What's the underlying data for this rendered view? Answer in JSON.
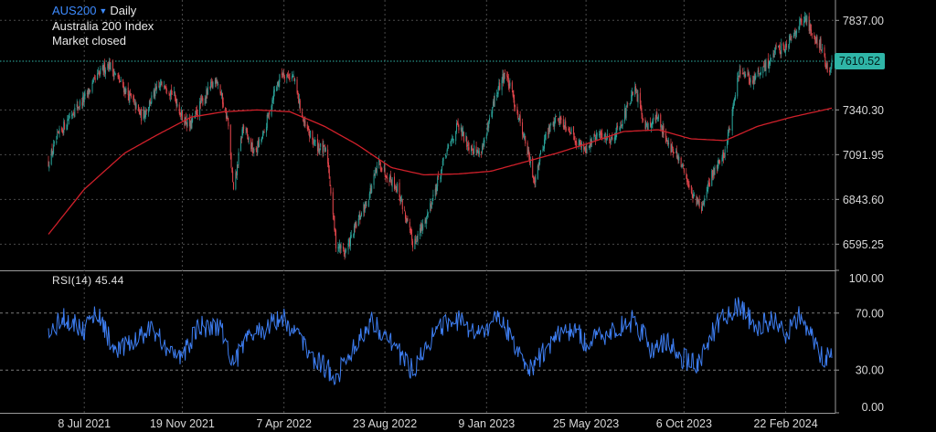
{
  "header": {
    "symbol": "AUS200",
    "symbol_icon": "chevron-down-icon",
    "timeframe": "Daily",
    "name": "Australia 200 Index",
    "status": "Market closed"
  },
  "last_price_label": "7610.52",
  "rsi_label": "RSI(14) 45.44",
  "colors": {
    "background": "#000000",
    "candle_up": "#2aa198",
    "candle_down": "#e0454b",
    "moving_average": "#d0202a",
    "rsi_line": "#3d7df0",
    "last_price": "#2fb5a7",
    "grid": "#4a4a4a"
  },
  "chart_data": [
    {
      "type": "candlestick",
      "title": "",
      "x_tick_labels": [
        "8 Jul 2021",
        "19 Nov 2021",
        "7 Apr 2022",
        "23 Aug 2022",
        "9 Jan 2023",
        "25 May 2023",
        "6 Oct 2023",
        "22 Feb 2024"
      ],
      "y_tick_labels": [
        "7837.00",
        "7340.30",
        "7091.95",
        "6843.60",
        "6595.25"
      ],
      "y_ticks": [
        7837.0,
        7340.3,
        7091.95,
        6843.6,
        6595.25
      ],
      "ylim": [
        6450,
        7950
      ],
      "last_price": 7610.52,
      "grid": true,
      "approximate_close_path": [
        [
          "2021-05-20",
          7050
        ],
        [
          "2021-06-03",
          7200
        ],
        [
          "2021-06-20",
          7320
        ],
        [
          "2021-07-08",
          7400
        ],
        [
          "2021-07-25",
          7520
        ],
        [
          "2021-08-10",
          7600
        ],
        [
          "2021-08-25",
          7500
        ],
        [
          "2021-09-10",
          7400
        ],
        [
          "2021-09-25",
          7300
        ],
        [
          "2021-10-10",
          7420
        ],
        [
          "2021-10-25",
          7500
        ],
        [
          "2021-11-10",
          7400
        ],
        [
          "2021-11-19",
          7300
        ],
        [
          "2021-11-30",
          7250
        ],
        [
          "2021-12-15",
          7380
        ],
        [
          "2022-01-05",
          7520
        ],
        [
          "2022-01-20",
          7280
        ],
        [
          "2022-01-28",
          6880
        ],
        [
          "2022-02-10",
          7250
        ],
        [
          "2022-02-25",
          7100
        ],
        [
          "2022-03-10",
          7200
        ],
        [
          "2022-03-25",
          7450
        ],
        [
          "2022-04-05",
          7550
        ],
        [
          "2022-04-20",
          7520
        ],
        [
          "2022-05-05",
          7250
        ],
        [
          "2022-05-20",
          7150
        ],
        [
          "2022-06-05",
          7100
        ],
        [
          "2022-06-17",
          6600
        ],
        [
          "2022-06-30",
          6550
        ],
        [
          "2022-07-15",
          6700
        ],
        [
          "2022-07-31",
          6850
        ],
        [
          "2022-08-15",
          7050
        ],
        [
          "2022-08-23",
          7000
        ],
        [
          "2022-09-10",
          6900
        ],
        [
          "2022-09-30",
          6600
        ],
        [
          "2022-10-15",
          6700
        ],
        [
          "2022-10-31",
          6900
        ],
        [
          "2022-11-15",
          7100
        ],
        [
          "2022-11-30",
          7250
        ],
        [
          "2022-12-15",
          7150
        ],
        [
          "2022-12-30",
          7100
        ],
        [
          "2023-01-09",
          7200
        ],
        [
          "2023-01-20",
          7400
        ],
        [
          "2023-02-03",
          7550
        ],
        [
          "2023-02-15",
          7400
        ],
        [
          "2023-03-01",
          7200
        ],
        [
          "2023-03-15",
          6950
        ],
        [
          "2023-03-31",
          7200
        ],
        [
          "2023-04-15",
          7300
        ],
        [
          "2023-04-30",
          7250
        ],
        [
          "2023-05-15",
          7150
        ],
        [
          "2023-05-25",
          7130
        ],
        [
          "2023-06-10",
          7200
        ],
        [
          "2023-06-30",
          7180
        ],
        [
          "2023-07-15",
          7300
        ],
        [
          "2023-07-31",
          7450
        ],
        [
          "2023-08-15",
          7250
        ],
        [
          "2023-08-31",
          7300
        ],
        [
          "2023-09-15",
          7150
        ],
        [
          "2023-09-30",
          7050
        ],
        [
          "2023-10-06",
          7000
        ],
        [
          "2023-10-20",
          6850
        ],
        [
          "2023-10-31",
          6800
        ],
        [
          "2023-11-15",
          7000
        ],
        [
          "2023-11-30",
          7100
        ],
        [
          "2023-12-10",
          7300
        ],
        [
          "2023-12-20",
          7550
        ],
        [
          "2024-01-05",
          7500
        ],
        [
          "2024-01-20",
          7550
        ],
        [
          "2024-02-05",
          7650
        ],
        [
          "2024-02-22",
          7700
        ],
        [
          "2024-03-08",
          7800
        ],
        [
          "2024-03-20",
          7850
        ],
        [
          "2024-03-31",
          7750
        ],
        [
          "2024-04-10",
          7700
        ],
        [
          "2024-04-19",
          7550
        ],
        [
          "2024-04-25",
          7610
        ]
      ],
      "moving_average": [
        [
          "2021-05-20",
          6650
        ],
        [
          "2021-07-08",
          6900
        ],
        [
          "2021-09-01",
          7100
        ],
        [
          "2021-10-15",
          7200
        ],
        [
          "2021-12-01",
          7300
        ],
        [
          "2022-01-15",
          7330
        ],
        [
          "2022-03-01",
          7340
        ],
        [
          "2022-04-15",
          7330
        ],
        [
          "2022-06-01",
          7250
        ],
        [
          "2022-07-15",
          7150
        ],
        [
          "2022-09-01",
          7020
        ],
        [
          "2022-10-15",
          6980
        ],
        [
          "2022-12-01",
          6985
        ],
        [
          "2023-01-15",
          7000
        ],
        [
          "2023-03-01",
          7050
        ],
        [
          "2023-04-15",
          7100
        ],
        [
          "2023-06-01",
          7160
        ],
        [
          "2023-07-15",
          7220
        ],
        [
          "2023-09-01",
          7230
        ],
        [
          "2023-10-15",
          7180
        ],
        [
          "2023-12-01",
          7170
        ],
        [
          "2024-01-15",
          7250
        ],
        [
          "2024-03-01",
          7300
        ],
        [
          "2024-04-25",
          7350
        ]
      ]
    },
    {
      "type": "line",
      "title": "RSI(14) 45.44",
      "y_tick_labels": [
        "100.00",
        "70.00",
        "30.00",
        "0.00"
      ],
      "y_ticks": [
        100,
        70,
        30,
        0
      ],
      "ylim": [
        0,
        100
      ],
      "reference_lines": [
        70,
        30
      ],
      "last_value": 45.44,
      "series": [
        {
          "points": [
            [
              "2021-05-20",
              55
            ],
            [
              "2021-06-10",
              68
            ],
            [
              "2021-07-08",
              58
            ],
            [
              "2021-07-25",
              72
            ],
            [
              "2021-08-20",
              42
            ],
            [
              "2021-09-10",
              48
            ],
            [
              "2021-10-05",
              60
            ],
            [
              "2021-11-01",
              45
            ],
            [
              "2021-11-19",
              38
            ],
            [
              "2021-12-10",
              60
            ],
            [
              "2022-01-10",
              62
            ],
            [
              "2022-01-28",
              35
            ],
            [
              "2022-02-20",
              55
            ],
            [
              "2022-03-15",
              60
            ],
            [
              "2022-04-05",
              68
            ],
            [
              "2022-04-25",
              55
            ],
            [
              "2022-05-15",
              40
            ],
            [
              "2022-06-17",
              25
            ],
            [
              "2022-07-10",
              45
            ],
            [
              "2022-08-05",
              65
            ],
            [
              "2022-08-23",
              55
            ],
            [
              "2022-09-15",
              40
            ],
            [
              "2022-09-30",
              30
            ],
            [
              "2022-10-20",
              50
            ],
            [
              "2022-11-10",
              60
            ],
            [
              "2022-12-01",
              65
            ],
            [
              "2022-12-20",
              55
            ],
            [
              "2023-01-09",
              60
            ],
            [
              "2023-01-25",
              68
            ],
            [
              "2023-02-10",
              55
            ],
            [
              "2023-03-10",
              30
            ],
            [
              "2023-03-31",
              45
            ],
            [
              "2023-04-20",
              55
            ],
            [
              "2023-05-10",
              60
            ],
            [
              "2023-05-25",
              48
            ],
            [
              "2023-06-20",
              55
            ],
            [
              "2023-07-10",
              60
            ],
            [
              "2023-07-31",
              65
            ],
            [
              "2023-08-20",
              45
            ],
            [
              "2023-09-10",
              50
            ],
            [
              "2023-09-30",
              40
            ],
            [
              "2023-10-06",
              38
            ],
            [
              "2023-10-25",
              35
            ],
            [
              "2023-11-20",
              62
            ],
            [
              "2023-12-10",
              72
            ],
            [
              "2023-12-20",
              76
            ],
            [
              "2024-01-10",
              60
            ],
            [
              "2024-02-05",
              65
            ],
            [
              "2024-02-22",
              55
            ],
            [
              "2024-03-10",
              68
            ],
            [
              "2024-03-31",
              50
            ],
            [
              "2024-04-15",
              38
            ],
            [
              "2024-04-25",
              45
            ]
          ]
        }
      ]
    }
  ]
}
